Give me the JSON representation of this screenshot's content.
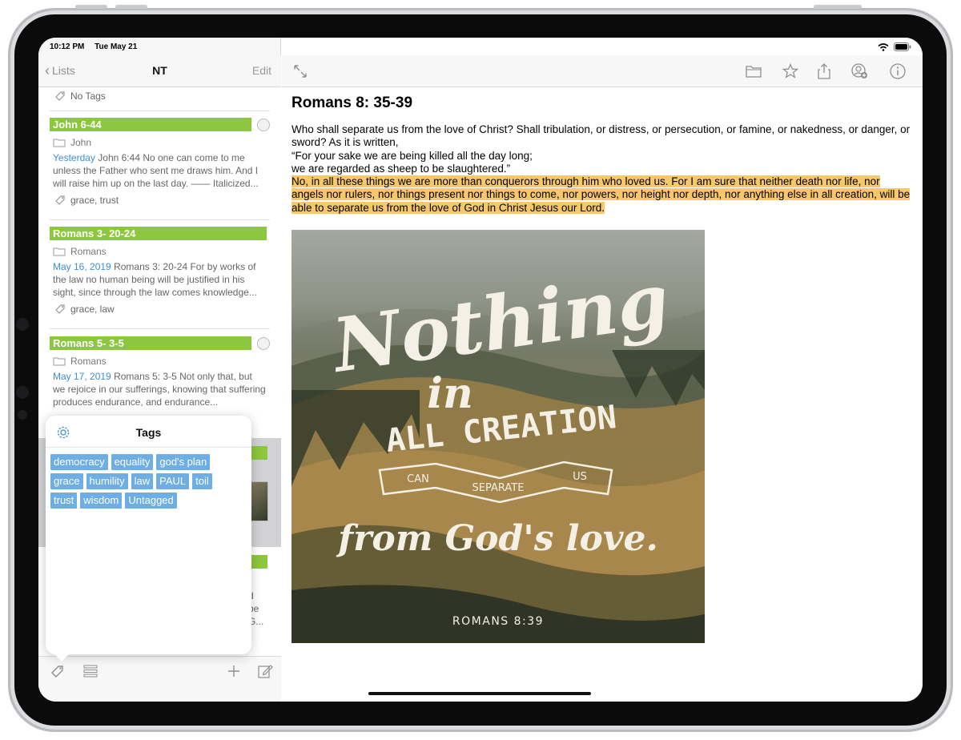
{
  "status": {
    "time": "10:12 PM",
    "date": "Tue May 21"
  },
  "sidebar": {
    "back_label": "Lists",
    "title": "NT",
    "edit_label": "Edit",
    "top_tags": "No Tags",
    "notes": [
      {
        "title": "John 6-44",
        "folder": "John",
        "date": "Yesterday",
        "snippet": "John 6:44 No one can come to me unless the Father who sent me draws him. And I will raise him up on the last day. —— Italicized...",
        "tags": "grace, trust"
      },
      {
        "title": "Romans 3- 20-24",
        "folder": "Romans",
        "date": "May 16, 2019",
        "snippet": "Romans 3: 20-24 For by works of the law no human being will be justified in his sight, since through the law comes knowledge...",
        "tags": "grace, law"
      },
      {
        "title": "Romans 5- 3-5",
        "folder": "Romans",
        "date": "May 17, 2019",
        "snippet": "Romans 5: 3-5 Not only that, but we rejoice in our sufferings, knowing that suffering produces endurance, and endurance...",
        "tags": ""
      }
    ],
    "partial_lines": [
      "d",
      "be",
      "G..."
    ]
  },
  "popover": {
    "title": "Tags",
    "tags": [
      "democracy",
      "equality",
      "god's plan",
      "grace",
      "humility",
      "law",
      "PAUL",
      "toil",
      "trust",
      "wisdom",
      "Untagged"
    ]
  },
  "main": {
    "heading": "Romans 8: 35-39",
    "verse_lines": [
      "Who shall separate us from the love of Christ? Shall tribulation, or distress, or persecution, or famine, or nakedness, or danger, or sword? As it is written,",
      "“For your sake we are being killed all the day long;",
      "we are regarded as sheep to be slaughtered.”"
    ],
    "highlighted": "No, in all these things we are more than conquerors through him who loved us. For I am sure that neither death nor life, nor angels nor rulers, nor things present nor things to come, nor powers, nor height nor depth, nor anything else in all creation, will be able to separate us from the love of God in Christ Jesus our Lord.",
    "image": {
      "line1": "Nothing",
      "line2": "in",
      "line3": "ALL CREATION",
      "ribbon_left": "CAN",
      "ribbon_mid": "SEPARATE",
      "ribbon_right": "US",
      "line4": "from God's love.",
      "reference": "ROMANS 8:39"
    }
  },
  "colors": {
    "tag_bar": "#8dc63f",
    "chip": "#6eaee6",
    "highlight": "#f6c86a",
    "date_blue": "#3d8fd6"
  }
}
